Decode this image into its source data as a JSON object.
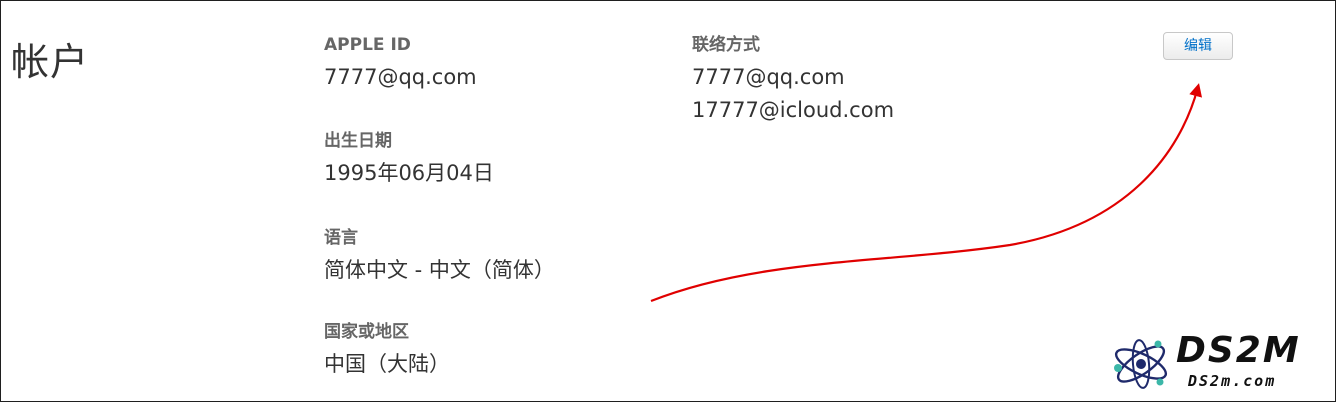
{
  "section": {
    "title": "帐户"
  },
  "apple_id": {
    "label": "APPLE ID",
    "value": "7777@qq.com"
  },
  "birthday": {
    "label": "出生日期",
    "value": "1995年06月04日"
  },
  "language": {
    "label": "语言",
    "value": "简体中文 - 中文（简体）"
  },
  "region": {
    "label": "国家或地区",
    "value": "中国（大陆）"
  },
  "contact": {
    "label": "联络方式",
    "emails": [
      "7777@qq.com",
      "17777@icloud.com"
    ]
  },
  "edit_button": {
    "label": "编辑"
  },
  "watermark": {
    "brand": "DS2M",
    "url": "DS2m.com"
  },
  "colors": {
    "link": "#0070c9",
    "arrow": "#e00000",
    "label": "#666666",
    "text": "#333333"
  }
}
